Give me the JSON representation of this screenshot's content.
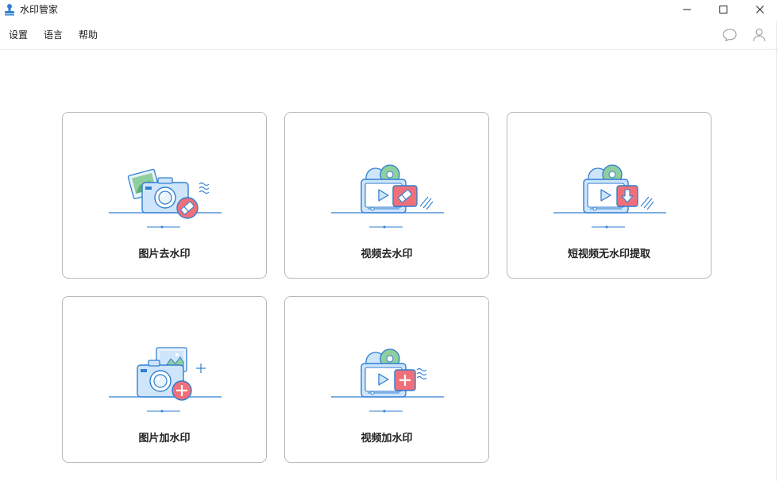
{
  "window": {
    "title": "水印管家",
    "controls": {
      "minimize": "minimize-icon",
      "maximize": "maximize-icon",
      "close": "close-icon"
    }
  },
  "menu": {
    "settings": "设置",
    "language": "语言",
    "help": "帮助"
  },
  "toolbar_icons": {
    "feedback": "chat-bubble-icon",
    "account": "user-icon"
  },
  "features": [
    {
      "label": "图片去水印",
      "icon": "camera-eraser-icon"
    },
    {
      "label": "视频去水印",
      "icon": "video-eraser-icon"
    },
    {
      "label": "短视频无水印提取",
      "icon": "video-download-icon"
    },
    {
      "label": "图片加水印",
      "icon": "camera-plus-icon"
    },
    {
      "label": "视频加水印",
      "icon": "video-plus-icon"
    }
  ],
  "colors": {
    "accent_blue": "#2f7fd1",
    "light_blue": "#cfe5fb",
    "green": "#8fcf9d",
    "red": "#f0707a",
    "card_border": "#b8b8b8"
  }
}
